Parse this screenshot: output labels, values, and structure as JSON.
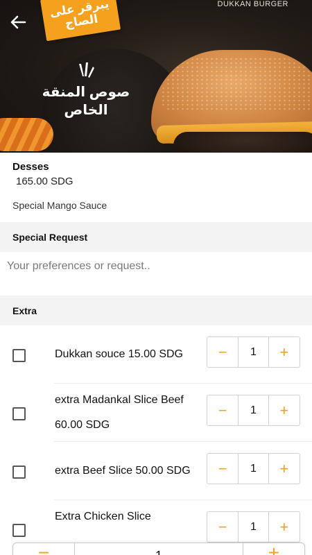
{
  "header": {
    "brand": "DUKKAN BURGER",
    "tag_line1": "يبرقر على",
    "tag_line2": "الصاج",
    "promo_line1": "صوص المنقة",
    "promo_line2": "الخاص",
    "accent_color": "#f5a11d"
  },
  "item": {
    "name": "Desses",
    "price": "165.00 SDG",
    "description": "Special Mango Sauce"
  },
  "special_request": {
    "title": "Special Request",
    "placeholder": "Your preferences or request.."
  },
  "extra": {
    "title": "Extra",
    "items": [
      {
        "label": "Dukkan souce  15.00 SDG",
        "qty": "1",
        "checked": false
      },
      {
        "label": "extra Madankal Slice Beef 60.00 SDG",
        "qty": "1",
        "checked": false
      },
      {
        "label": "extra Beef Slice  50.00 SDG",
        "qty": "1",
        "checked": false
      },
      {
        "label": "Extra Chicken Slice",
        "qty": "1",
        "checked": false
      }
    ]
  },
  "order_quantity": {
    "minus": "−",
    "qty": "1",
    "plus": "+"
  },
  "stepper_symbols": {
    "minus": "−",
    "plus": "+"
  }
}
